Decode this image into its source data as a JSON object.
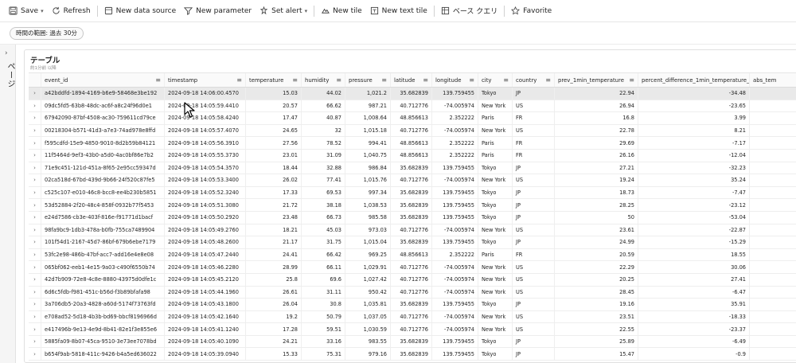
{
  "toolbar": {
    "save": "Save",
    "refresh": "Refresh",
    "new_data_source": "New data source",
    "new_parameter": "New parameter",
    "set_alert": "Set alert",
    "new_tile": "New tile",
    "new_text_tile": "New text tile",
    "base_query": "ベース クエリ",
    "favorite": "Favorite"
  },
  "filter": {
    "time_range": "時間の範囲: 過去 30分"
  },
  "rail": {
    "label": "ページ"
  },
  "tile": {
    "title": "テーブル",
    "subtitle": "約1分前 以降"
  },
  "table": {
    "columns": [
      "event_id",
      "timestamp",
      "temperature",
      "humidity",
      "pressure",
      "latitude",
      "longitude",
      "city",
      "country",
      "prev_1min_temperature",
      "percent_difference_1min_temperature_",
      "abs_tem"
    ],
    "rows": [
      [
        "a42bddfd-1894-4169-b6e9-58468e3be192",
        "2024-09-18 14:06:00.4570",
        "15.03",
        "44.02",
        "1,021.2",
        "35.682839",
        "139.759455",
        "Tokyo",
        "JP",
        "22.94",
        "-34.48"
      ],
      [
        "09dc5fd5-63b8-48dc-ac6f-a8c24f96d0e1",
        "2024-09-18 14:05:59.4410",
        "20.57",
        "66.62",
        "987.21",
        "40.712776",
        "-74.005974",
        "New York",
        "US",
        "26.94",
        "-23.65"
      ],
      [
        "67942090-87bf-4508-ac30-759611cd79ce",
        "2024-09-18 14:05:58.4240",
        "17.47",
        "40.87",
        "1,008.64",
        "48.856613",
        "2.352222",
        "Paris",
        "FR",
        "16.8",
        "3.99"
      ],
      [
        "00218304-b571-41d3-a7e3-74ad978e8ffd",
        "2024-09-18 14:05:57.4070",
        "24.65",
        "32",
        "1,015.18",
        "40.712776",
        "-74.005974",
        "New York",
        "US",
        "22.78",
        "8.21"
      ],
      [
        "f595cdfd-15e9-4850-9010-8d2b59b84121",
        "2024-09-18 14:05:56.3910",
        "27.56",
        "78.52",
        "994.41",
        "48.856613",
        "2.352222",
        "Paris",
        "FR",
        "29.69",
        "-7.17"
      ],
      [
        "11f5464d-9ef3-43b0-a5d0-4ac0bf86e7b2",
        "2024-09-18 14:05:55.3730",
        "23.01",
        "31.09",
        "1,040.75",
        "48.856613",
        "2.352222",
        "Paris",
        "FR",
        "26.16",
        "-12.04"
      ],
      [
        "71e9c451-121d-451a-8f65-2e95cc59347d",
        "2024-09-18 14:05:54.3570",
        "18.44",
        "32.88",
        "986.84",
        "35.682839",
        "139.759455",
        "Tokyo",
        "JP",
        "27.21",
        "-32.23"
      ],
      [
        "02ca518d-67bd-439d-9b66-24f520c87fe5",
        "2024-09-18 14:05:53.3400",
        "26.02",
        "77.41",
        "1,015.76",
        "40.712776",
        "-74.005974",
        "New York",
        "US",
        "19.24",
        "35.24"
      ],
      [
        "c525c107-e010-46c8-bcc8-ee4b230b5851",
        "2024-09-18 14:05:52.3240",
        "17.33",
        "69.53",
        "997.34",
        "35.682839",
        "139.759455",
        "Tokyo",
        "JP",
        "18.73",
        "-7.47"
      ],
      [
        "53d52884-2f20-48c4-858f-0932b77f5453",
        "2024-09-18 14:05:51.3080",
        "21.72",
        "38.18",
        "1,038.53",
        "35.682839",
        "139.759455",
        "Tokyo",
        "JP",
        "28.25",
        "-23.12"
      ],
      [
        "e24d7586-cb3e-403f-816e-f91771d1bacf",
        "2024-09-18 14:05:50.2920",
        "23.48",
        "66.73",
        "985.58",
        "35.682839",
        "139.759455",
        "Tokyo",
        "JP",
        "50",
        "-53.04"
      ],
      [
        "98fa9bc9-1db3-478a-b0fb-755ca7489904",
        "2024-09-18 14:05:49.2760",
        "18.21",
        "45.03",
        "973.03",
        "40.712776",
        "-74.005974",
        "New York",
        "US",
        "23.61",
        "-22.87"
      ],
      [
        "101f54d1-2167-45d7-86bf-679b6ebe7179",
        "2024-09-18 14:05:48.2600",
        "21.17",
        "31.75",
        "1,015.04",
        "35.682839",
        "139.759455",
        "Tokyo",
        "JP",
        "24.99",
        "-15.29"
      ],
      [
        "53fc2e98-486b-47bf-acc7-add16e4e8e08",
        "2024-09-18 14:05:47.2440",
        "24.41",
        "66.42",
        "969.25",
        "48.856613",
        "2.352222",
        "Paris",
        "FR",
        "20.59",
        "18.55"
      ],
      [
        "065bf062-eeb1-4e15-9a03-c490f6550b74",
        "2024-09-18 14:05:46.2280",
        "28.99",
        "66.11",
        "1,029.91",
        "40.712776",
        "-74.005974",
        "New York",
        "US",
        "22.29",
        "30.06"
      ],
      [
        "42d7b909-72e8-4c8e-8880-43975d0dfe1c",
        "2024-09-18 14:05:45.2120",
        "25.8",
        "69.6",
        "1,027.42",
        "40.712776",
        "-74.005974",
        "New York",
        "US",
        "20.25",
        "27.41"
      ],
      [
        "6d6c5fdb-f981-451c-b56d-f3b89bfafa98",
        "2024-09-18 14:05:44.1960",
        "26.61",
        "31.11",
        "950.42",
        "40.712776",
        "-74.005974",
        "New York",
        "US",
        "28.45",
        "-6.47"
      ],
      [
        "3a706db5-20a3-4828-a60d-5174f73763fd",
        "2024-09-18 14:05:43.1800",
        "26.04",
        "30.8",
        "1,035.81",
        "35.682839",
        "139.759455",
        "Tokyo",
        "JP",
        "19.16",
        "35.91"
      ],
      [
        "e708ad52-5d18-4b3b-bd69-bbcf8196966d",
        "2024-09-18 14:05:42.1640",
        "19.2",
        "50.79",
        "1,037.05",
        "40.712776",
        "-74.005974",
        "New York",
        "US",
        "23.51",
        "-18.33"
      ],
      [
        "e417496b-9e13-4e9d-8b41-82e1f3e855e6",
        "2024-09-18 14:05:41.1240",
        "17.28",
        "59.51",
        "1,030.59",
        "40.712776",
        "-74.005974",
        "New York",
        "US",
        "22.55",
        "-23.37"
      ],
      [
        "5885fa09-8b07-45ca-9510-3e73ee7078bd",
        "2024-09-18 14:05:40.1090",
        "24.21",
        "33.16",
        "983.55",
        "35.682839",
        "139.759455",
        "Tokyo",
        "JP",
        "25.89",
        "-6.49"
      ],
      [
        "b654f9ab-5818-411c-9426-b4a5ed636022",
        "2024-09-18 14:05:39.0940",
        "15.33",
        "75.31",
        "979.16",
        "35.682839",
        "139.759455",
        "Tokyo",
        "JP",
        "15.47",
        "-0.9"
      ]
    ]
  }
}
